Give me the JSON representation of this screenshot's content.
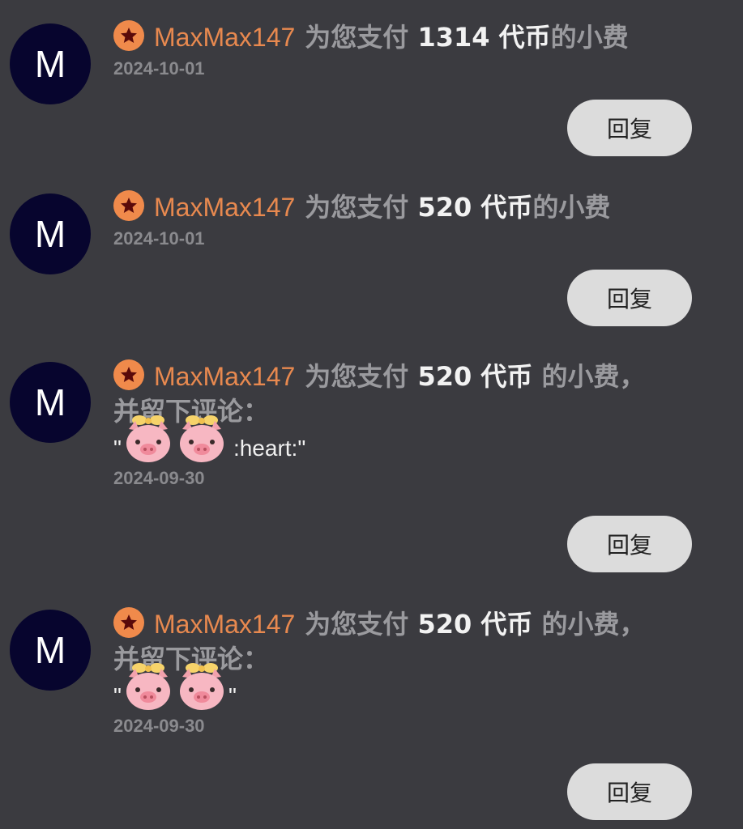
{
  "colors": {
    "background": "#3b3b40",
    "avatar": "#07052e",
    "username": "#e8894f",
    "badge": "#f08a4b",
    "reply_button": "#dcdcdc"
  },
  "notifications": [
    {
      "avatar_letter": "M",
      "username": "MaxMax147",
      "prefix": "为您支付",
      "amount": "1314",
      "currency": "代币",
      "suffix": "的小费",
      "date": "2024-10-01",
      "reply_label": "回复"
    },
    {
      "avatar_letter": "M",
      "username": "MaxMax147",
      "prefix": "为您支付",
      "amount": "520",
      "currency": "代币",
      "suffix": "的小费",
      "date": "2024-10-01",
      "reply_label": "回复"
    },
    {
      "avatar_letter": "M",
      "username": "MaxMax147",
      "prefix": "为您支付",
      "amount": "520",
      "currency": "代币",
      "suffix": " 的小费，并留下评论：",
      "quote_open": "\"",
      "comment_text": " :heart:\"",
      "date": "2024-09-30",
      "reply_label": "回复"
    },
    {
      "avatar_letter": "M",
      "username": "MaxMax147",
      "prefix": "为您支付",
      "amount": "520",
      "currency": "代币",
      "suffix": " 的小费，并留下评论：",
      "quote_open": "\"",
      "comment_text": "\"",
      "date": "2024-09-30",
      "reply_label": "回复"
    }
  ]
}
